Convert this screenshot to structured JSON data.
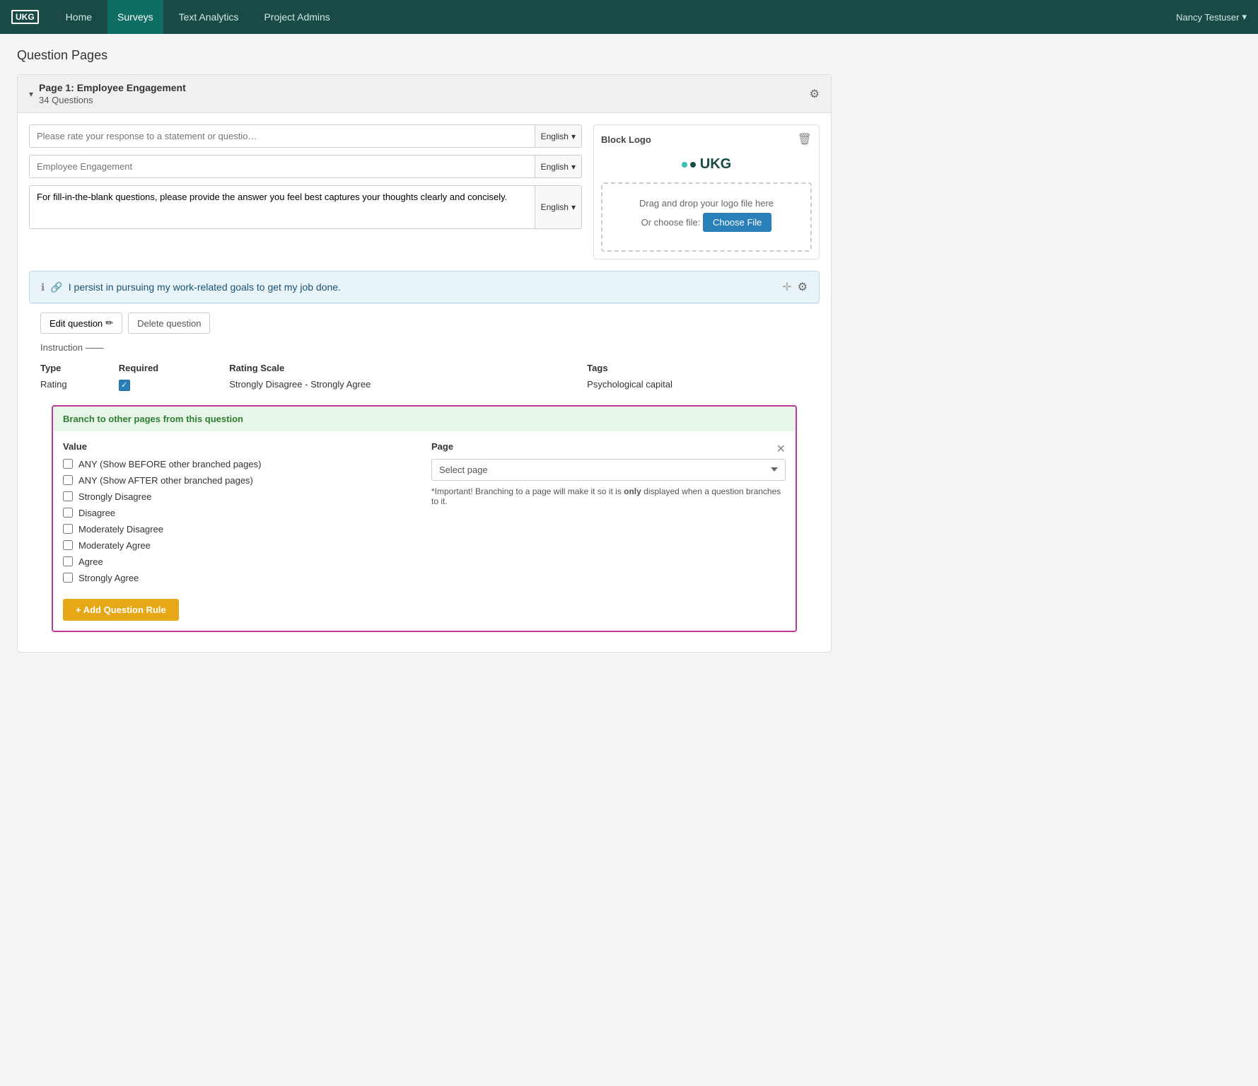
{
  "navbar": {
    "brand": "UKG",
    "links": [
      "Home",
      "Surveys",
      "Text Analytics",
      "Project Admins"
    ],
    "active_link": "Surveys",
    "user": "Nancy Testuser"
  },
  "page": {
    "title": "Question Pages"
  },
  "card": {
    "page_label": "Page 1: Employee Engagement",
    "questions_count": "34 Questions"
  },
  "block_inputs": {
    "input1_placeholder": "Please rate your response to a statement or questio…",
    "input1_lang": "English",
    "input2_placeholder": "Employee Engagement",
    "input2_lang": "English",
    "textarea_text": "For fill-in-the-blank questions, please provide the answer you feel best captures your thoughts clearly and concisely.",
    "textarea_lang": "English"
  },
  "logo_block": {
    "title": "Block Logo",
    "drag_text": "Drag and drop your logo file here",
    "or_text": "Or choose file:",
    "choose_btn": "Choose File"
  },
  "question": {
    "text": "I persist in pursuing my work-related goals to get my job done."
  },
  "edit_panel": {
    "edit_btn": "Edit question",
    "delete_btn": "Delete question",
    "instruction_label": "Instruction ——",
    "type_col": "Type",
    "required_col": "Required",
    "rating_scale_col": "Rating Scale",
    "tags_col": "Tags",
    "type_val": "Rating",
    "rating_scale_val": "Strongly Disagree - Strongly Agree",
    "tags_val": "Psychological capital"
  },
  "branch": {
    "header": "Branch to other pages from this question",
    "value_col": "Value",
    "page_col": "Page",
    "options": [
      "ANY (Show BEFORE other branched pages)",
      "ANY (Show AFTER other branched pages)",
      "Strongly Disagree",
      "Disagree",
      "Moderately Disagree",
      "Moderately Agree",
      "Agree",
      "Strongly Agree"
    ],
    "select_placeholder": "Select page",
    "note_part1": "*Important! Branching to a page will make it so it is ",
    "note_bold": "only",
    "note_part2": " displayed when a question branches to it.",
    "add_rule_btn": "+ Add Question Rule"
  }
}
